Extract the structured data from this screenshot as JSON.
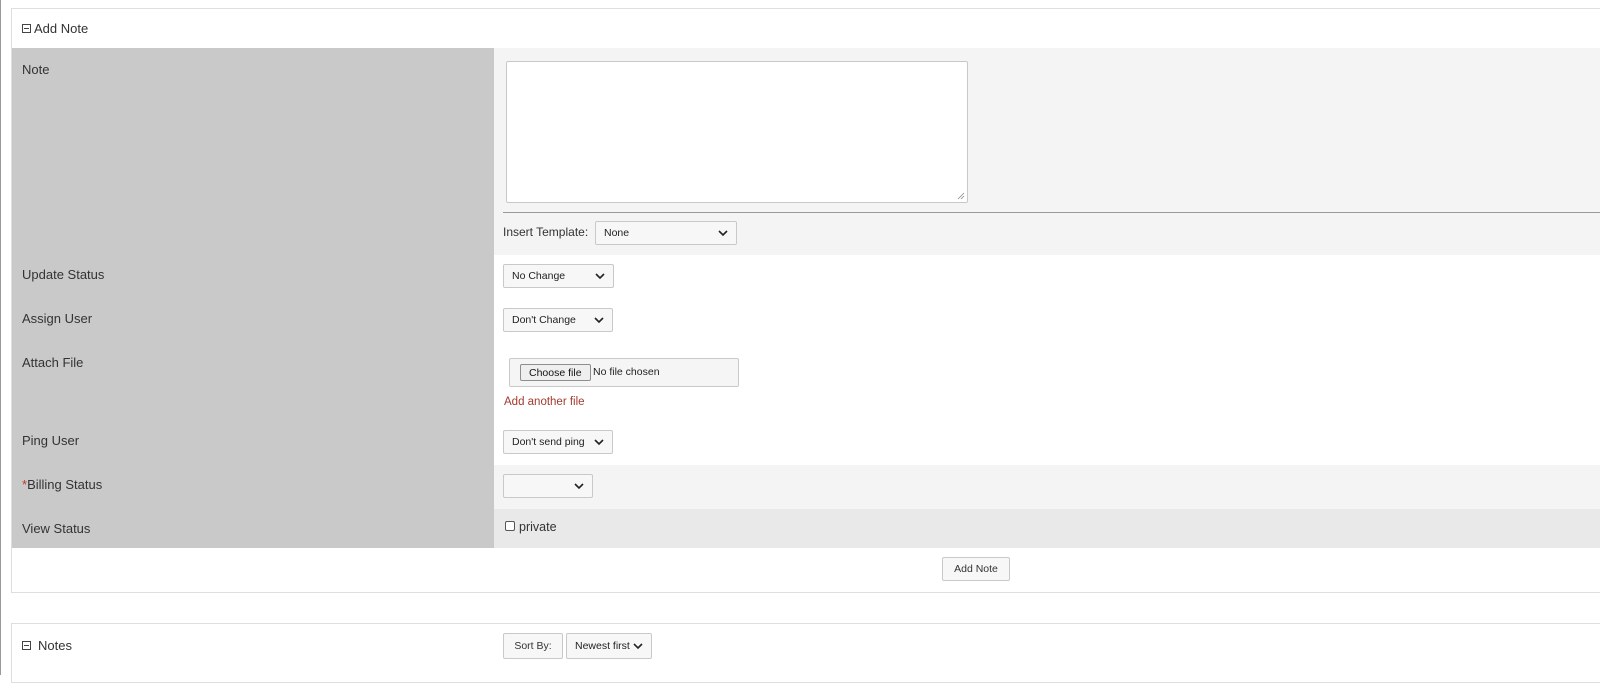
{
  "add_note_panel": {
    "title": "Add Note",
    "note": {
      "label": "Note",
      "value": ""
    },
    "insert_template": {
      "label": "Insert Template:",
      "selected": "None"
    },
    "update_status": {
      "label": "Update Status",
      "selected": "No Change"
    },
    "assign_user": {
      "label": "Assign User",
      "selected": "Don't Change"
    },
    "attach_file": {
      "label": "Attach File",
      "choose_button": "Choose file",
      "status_text": "No file chosen",
      "add_another": "Add another file"
    },
    "ping_user": {
      "label": "Ping User",
      "selected": "Don't send ping"
    },
    "billing_status": {
      "required_mark": "*",
      "label": "Billing Status",
      "selected": ""
    },
    "view_status": {
      "label": "View Status",
      "checkbox_label": "private",
      "checked": false
    },
    "submit_button": "Add Note"
  },
  "notes_panel": {
    "title": "Notes",
    "sort_by_label": "Sort By:",
    "sort_selected": "Newest first"
  },
  "icons": [
    "collapse-icon",
    "chevron-down-icon",
    "checkbox-icon",
    "resize-grip-icon"
  ],
  "colors": {
    "label_column": "#c9c9c9",
    "row_light": "#f4f4f4",
    "row_medium": "#e9e9e9",
    "link_red": "#a33a2e",
    "required_red": "#c0392b"
  }
}
